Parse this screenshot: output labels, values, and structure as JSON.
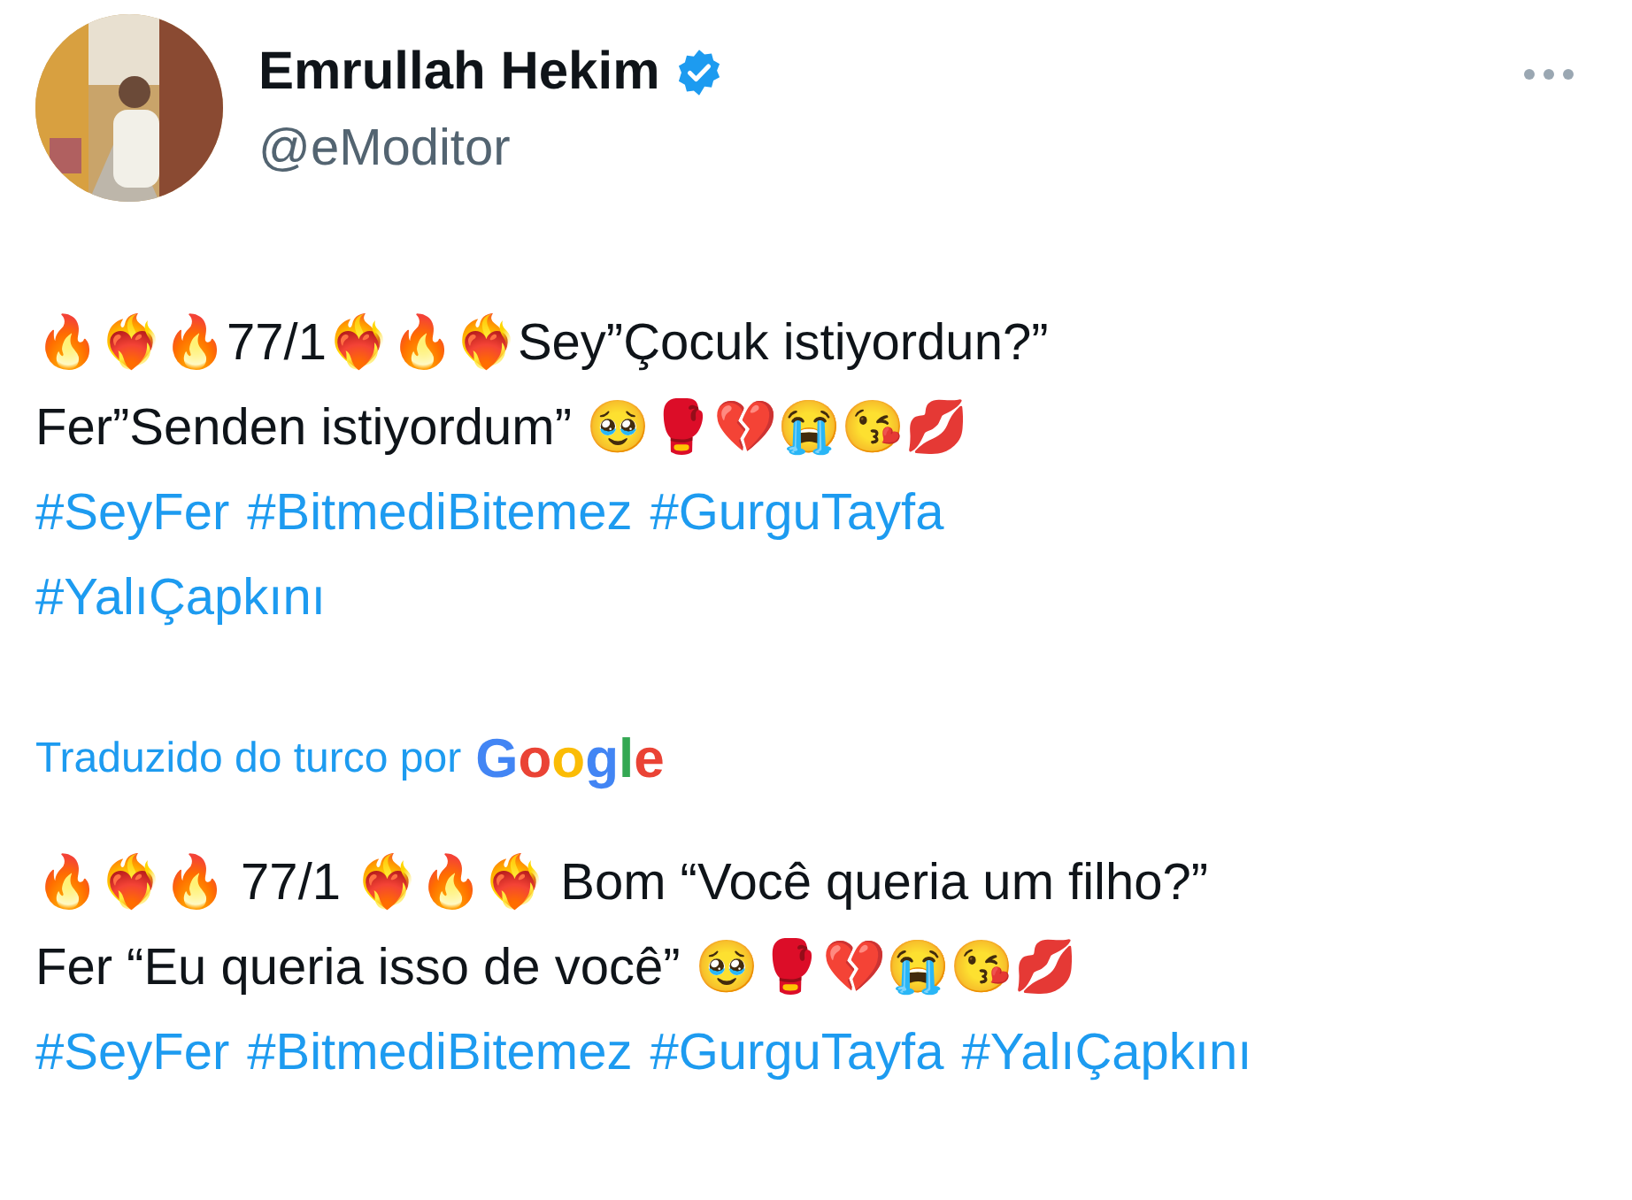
{
  "author": {
    "name": "Emrullah Hekim",
    "handle": "@eModitor",
    "verified": true
  },
  "original": {
    "lines": [
      "🔥❤️‍🔥🔥77/1❤️‍🔥🔥❤️‍🔥Sey”Çocuk istiyordun?”",
      "Fer”Senden istiyordum” 🥹🥊💔😭😘💋"
    ],
    "hashtag_lines": [
      [
        "#SeyFer",
        "#BitmediBitemez",
        "#GurguTayfa"
      ],
      [
        "#YalıÇapkını"
      ]
    ]
  },
  "translation": {
    "label": "Traduzido do turco por",
    "provider": "Google"
  },
  "translated": {
    "lines": [
      "🔥❤️‍🔥🔥 77/1 ❤️‍🔥🔥❤️‍🔥 Bom “Você queria um filho?”",
      "Fer “Eu queria isso de você” 🥹🥊💔😭😘💋"
    ],
    "hashtag_lines": [
      [
        "#SeyFer",
        "#BitmediBitemez",
        "#GurguTayfa",
        "#YalıÇapkını"
      ]
    ]
  }
}
